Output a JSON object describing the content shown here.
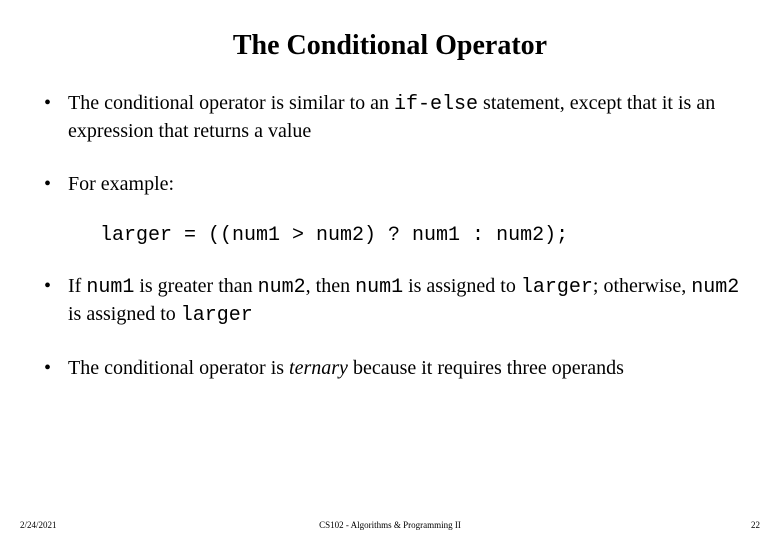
{
  "title": "The Conditional Operator",
  "bullets": {
    "b1_pre": "The conditional operator is similar to an ",
    "b1_code": "if-else",
    "b1_post": " statement, except that it is an expression that returns a value",
    "b2": "For example:",
    "example_code": "larger = ((num1 > num2) ? num1 : num2);",
    "b3_t1": "If ",
    "b3_c1": "num1",
    "b3_t2": " is greater than ",
    "b3_c2": "num2",
    "b3_t3": ", then ",
    "b3_c3": "num1",
    "b3_t4": " is assigned to ",
    "b3_c4": "larger",
    "b3_t5": "; otherwise, ",
    "b3_c5": "num2",
    "b3_t6": " is assigned to ",
    "b3_c6": "larger",
    "b4_pre": "The conditional operator is ",
    "b4_italic": "ternary",
    "b4_post": " because it requires three operands"
  },
  "footer": {
    "date": "2/24/2021",
    "course": "CS102 - Algorithms & Programming II",
    "page": "22"
  }
}
